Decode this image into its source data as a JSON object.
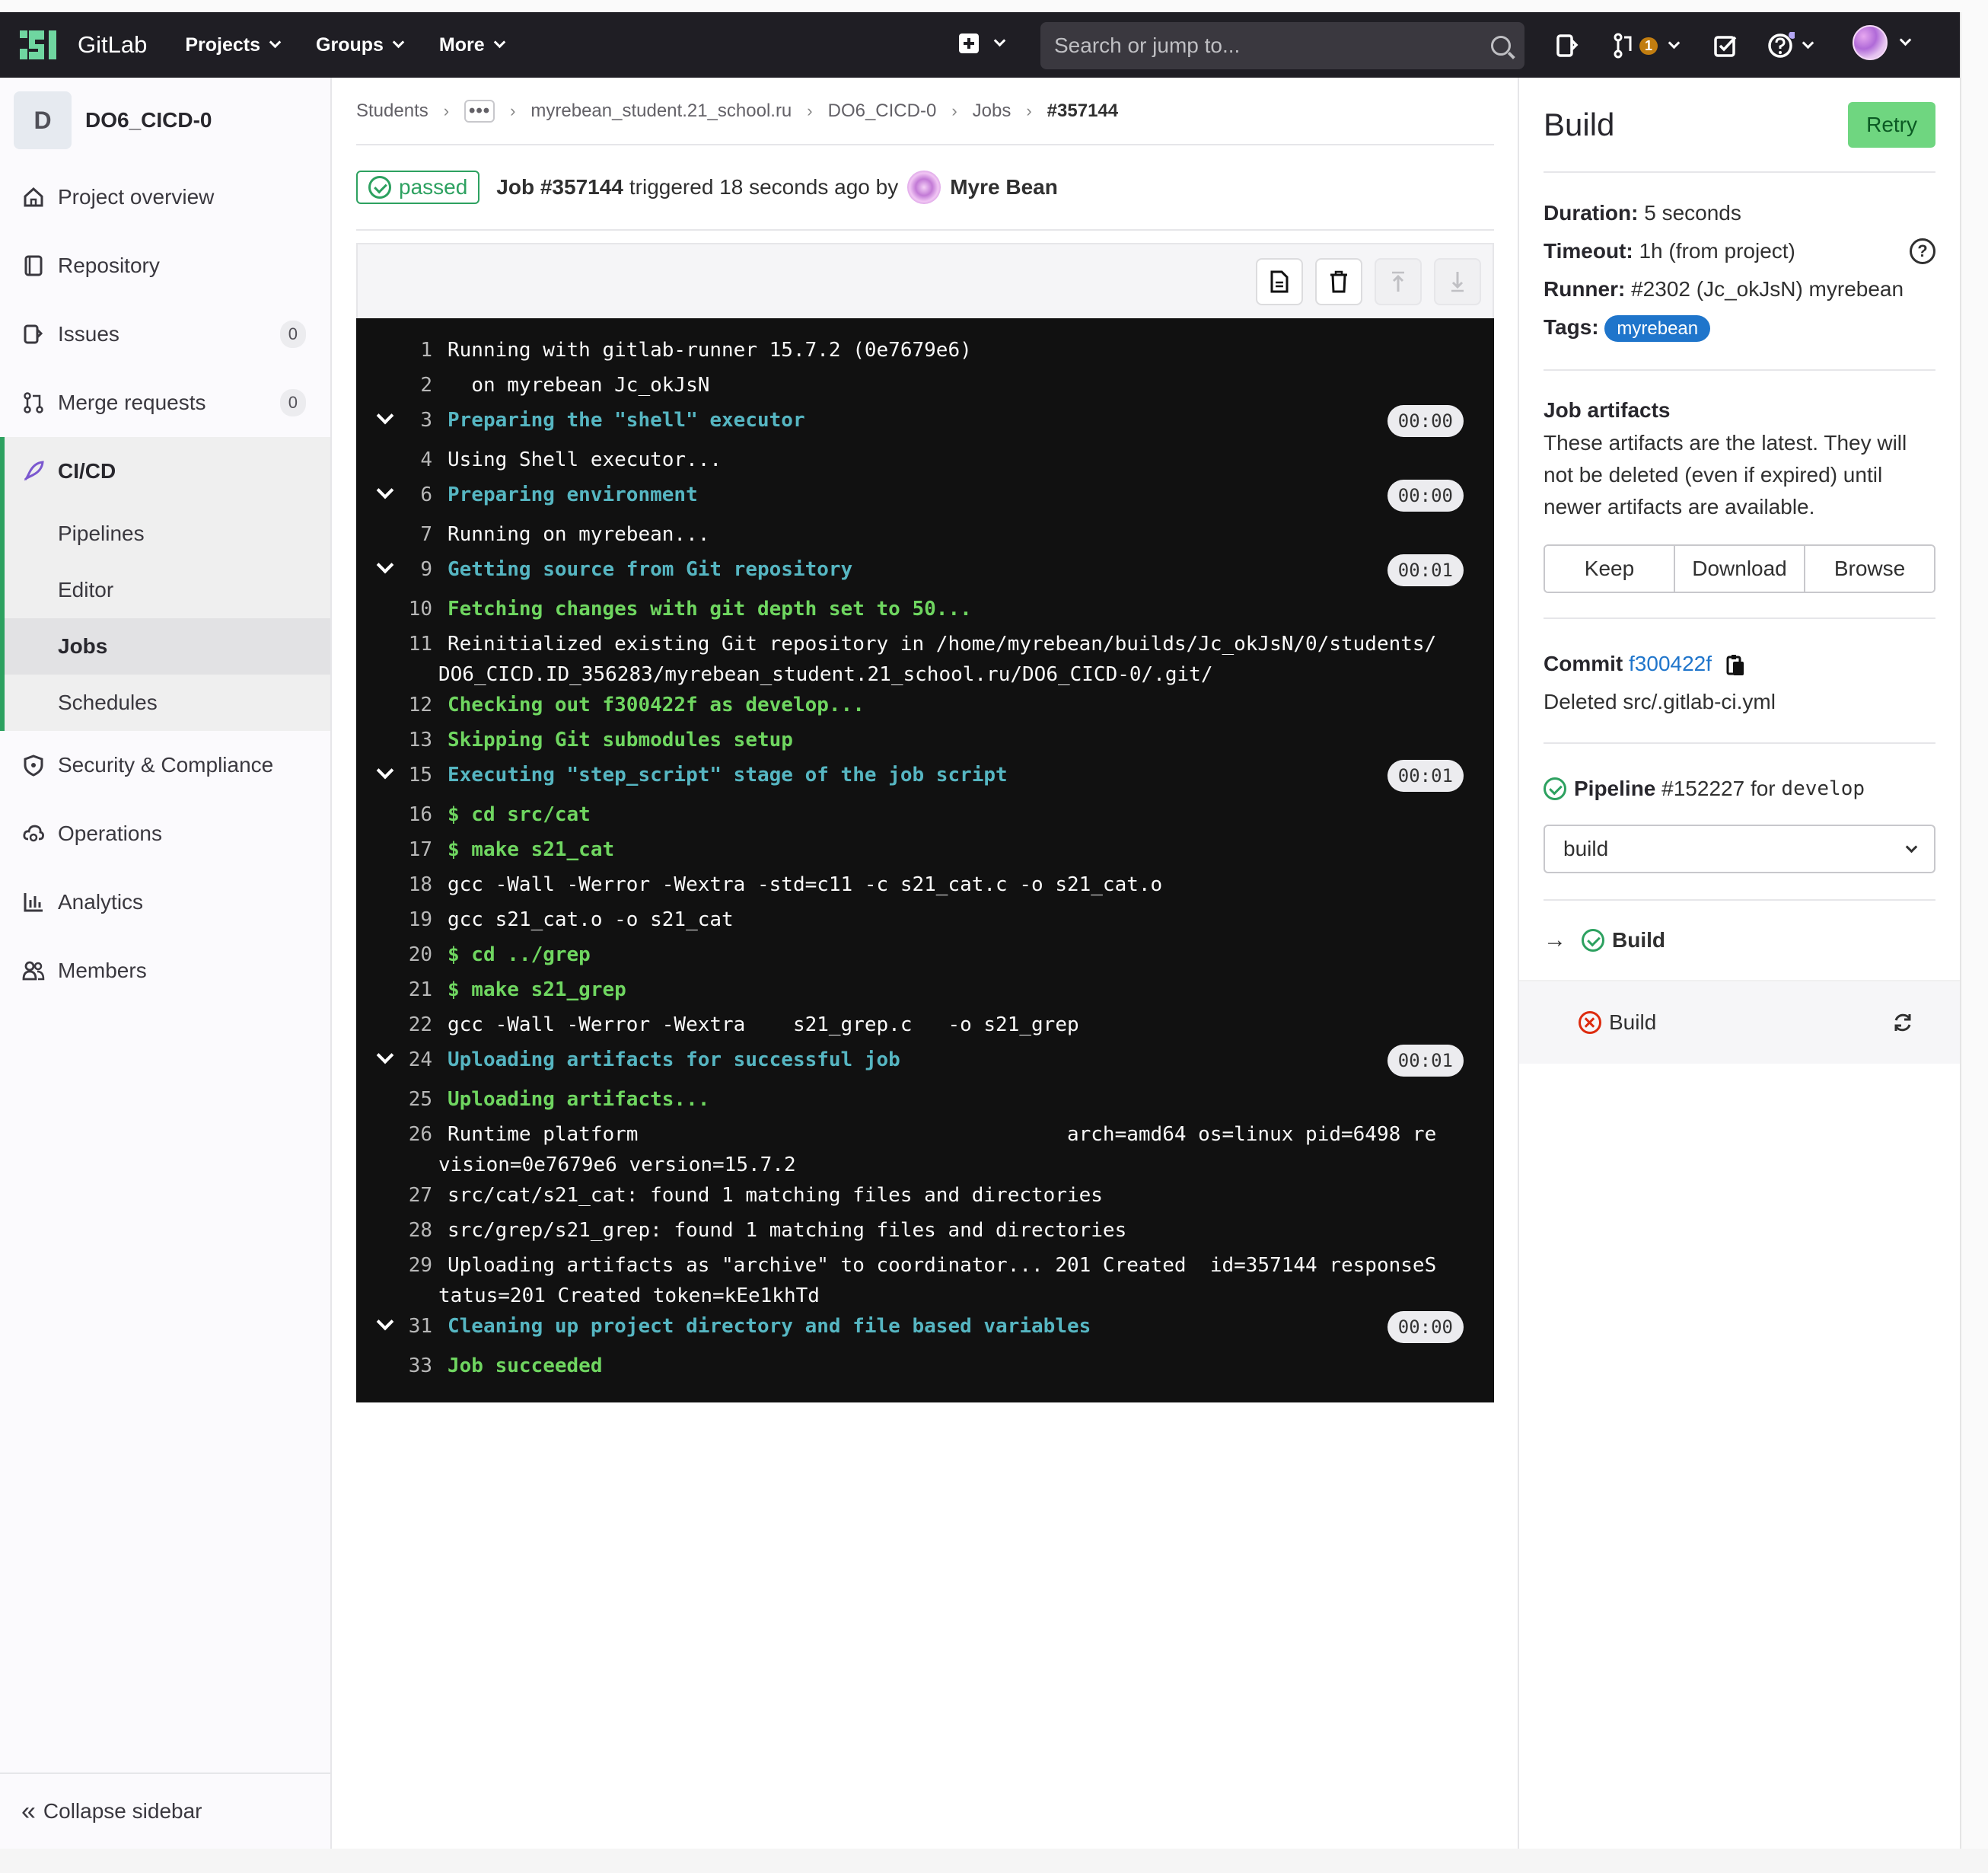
{
  "topbar": {
    "brand": "GitLab",
    "menu": [
      "Projects",
      "Groups",
      "More"
    ],
    "search_placeholder": "Search or jump to...",
    "mr_badge": "1"
  },
  "sidebar": {
    "project_initial": "D",
    "project_name": "DO6_CICD-0",
    "items": [
      {
        "label": "Project overview",
        "icon": "home-icon"
      },
      {
        "label": "Repository",
        "icon": "book-icon"
      },
      {
        "label": "Issues",
        "icon": "issues-icon",
        "count": "0"
      },
      {
        "label": "Merge requests",
        "icon": "merge-request-icon",
        "count": "0"
      },
      {
        "label": "CI/CD",
        "icon": "rocket-icon"
      }
    ],
    "cicd_sub": [
      "Pipelines",
      "Editor",
      "Jobs",
      "Schedules"
    ],
    "after_items": [
      {
        "label": "Security & Compliance",
        "icon": "shield-icon"
      },
      {
        "label": "Operations",
        "icon": "cloud-gear-icon"
      },
      {
        "label": "Analytics",
        "icon": "chart-icon"
      },
      {
        "label": "Members",
        "icon": "users-icon"
      }
    ],
    "collapse_label": "Collapse sidebar"
  },
  "breadcrumb": {
    "items": [
      "Students",
      "myrebean_student.21_school.ru",
      "DO6_CICD-0",
      "Jobs"
    ],
    "current": "#357144"
  },
  "job": {
    "status": "passed",
    "title": "Job #357144",
    "triggered": "triggered 18 seconds ago by",
    "user": "Myre Bean"
  },
  "log": {
    "lines": [
      {
        "n": "1",
        "t": "Running with gitlab-runner 15.7.2 (0e7679e6)",
        "s": "plain"
      },
      {
        "n": "2",
        "t": "  on myrebean Jc_okJsN",
        "s": "plain"
      },
      {
        "n": "3",
        "t": "Preparing the \"shell\" executor",
        "s": "section",
        "dur": "00:00"
      },
      {
        "n": "4",
        "t": "Using Shell executor...",
        "s": "plain"
      },
      {
        "n": "6",
        "t": "Preparing environment",
        "s": "section",
        "dur": "00:00"
      },
      {
        "n": "7",
        "t": "Running on myrebean...",
        "s": "plain"
      },
      {
        "n": "9",
        "t": "Getting source from Git repository",
        "s": "section",
        "dur": "00:01"
      },
      {
        "n": "10",
        "t": "Fetching changes with git depth set to 50...",
        "s": "green"
      },
      {
        "n": "11",
        "t": "Reinitialized existing Git repository in /home/myrebean/builds/Jc_okJsN/0/students/",
        "t2": "DO6_CICD.ID_356283/myrebean_student.21_school.ru/DO6_CICD-0/.git/",
        "s": "plain"
      },
      {
        "n": "12",
        "t": "Checking out f300422f as develop...",
        "s": "green"
      },
      {
        "n": "13",
        "t": "Skipping Git submodules setup",
        "s": "green"
      },
      {
        "n": "15",
        "t": "Executing \"step_script\" stage of the job script",
        "s": "section",
        "dur": "00:01"
      },
      {
        "n": "16",
        "t": "$ cd src/cat",
        "s": "green"
      },
      {
        "n": "17",
        "t": "$ make s21_cat",
        "s": "green"
      },
      {
        "n": "18",
        "t": "gcc -Wall -Werror -Wextra -std=c11 -c s21_cat.c -o s21_cat.o",
        "s": "plain"
      },
      {
        "n": "19",
        "t": "gcc s21_cat.o -o s21_cat",
        "s": "plain"
      },
      {
        "n": "20",
        "t": "$ cd ../grep",
        "s": "green"
      },
      {
        "n": "21",
        "t": "$ make s21_grep",
        "s": "green"
      },
      {
        "n": "22",
        "t": "gcc -Wall -Werror -Wextra    s21_grep.c   -o s21_grep",
        "s": "plain"
      },
      {
        "n": "24",
        "t": "Uploading artifacts for successful job",
        "s": "section",
        "dur": "00:01"
      },
      {
        "n": "25",
        "t": "Uploading artifacts...",
        "s": "green"
      },
      {
        "n": "26",
        "t": "Runtime platform                                    arch=amd64 os=linux pid=6498 re",
        "t2": "vision=0e7679e6 version=15.7.2",
        "s": "plain"
      },
      {
        "n": "27",
        "t": "src/cat/s21_cat: found 1 matching files and directories",
        "s": "plain"
      },
      {
        "n": "28",
        "t": "src/grep/s21_grep: found 1 matching files and directories",
        "s": "plain"
      },
      {
        "n": "29",
        "t": "Uploading artifacts as \"archive\" to coordinator... 201 Created  id=357144 responseS",
        "t2": "tatus=201 Created token=kEe1khTd",
        "s": "plain"
      },
      {
        "n": "31",
        "t": "Cleaning up project directory and file based variables",
        "s": "section",
        "dur": "00:00"
      },
      {
        "n": "33",
        "t": "Job succeeded",
        "s": "green"
      }
    ]
  },
  "panel": {
    "title": "Build",
    "retry": "Retry",
    "duration_label": "Duration:",
    "duration": "5 seconds",
    "timeout_label": "Timeout:",
    "timeout": "1h (from project)",
    "runner_label": "Runner:",
    "runner": "#2302 (Jc_okJsN) myrebean",
    "tags_label": "Tags:",
    "tag": "myrebean",
    "artifacts_title": "Job artifacts",
    "artifacts_desc": "These artifacts are the latest. They will not be deleted (even if expired) until newer artifacts are available.",
    "artifact_buttons": [
      "Keep",
      "Download",
      "Browse"
    ],
    "commit_label": "Commit",
    "commit_sha": "f300422f",
    "commit_msg": "Deleted src/.gitlab-ci.yml",
    "pipeline_label": "Pipeline",
    "pipeline_id": "#152227",
    "pipeline_for": "for",
    "pipeline_branch": "develop",
    "stage_select": "build",
    "jobs": [
      {
        "name": "Build",
        "status": "success",
        "current": true
      },
      {
        "name": "Build",
        "status": "failed",
        "current": false
      }
    ]
  },
  "colors": {
    "accent_green": "#2da160",
    "retry_bg": "#6fd680",
    "link_blue": "#1f75cb",
    "failed_red": "#dd2b0e"
  }
}
